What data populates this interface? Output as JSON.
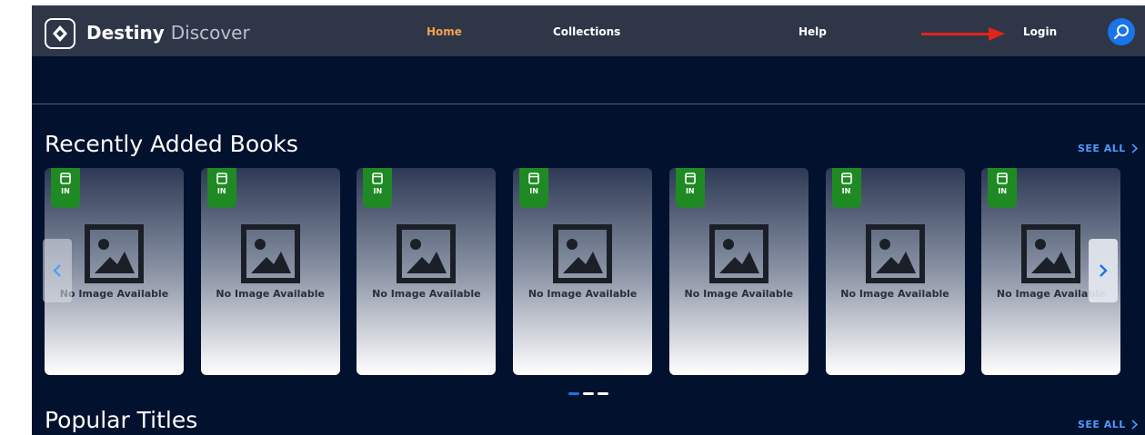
{
  "brand": {
    "name_primary": "Destiny",
    "name_secondary": "Discover",
    "logo_icon": "destiny-logo-icon"
  },
  "nav": {
    "home": "Home",
    "collections": "Collections",
    "help": "Help",
    "login": "Login",
    "search_icon": "search-icon"
  },
  "colors": {
    "background": "#02112e",
    "navbar": "#2e3648",
    "active_nav": "#f6a04d",
    "accent": "#1a73e8",
    "badge": "#1f8a24",
    "annotation_arrow": "#e3241b"
  },
  "sections": {
    "recent": {
      "title": "Recently Added Books",
      "see_all": "SEE ALL",
      "cards": [
        {
          "badge": "IN",
          "image_text": "No Image Available"
        },
        {
          "badge": "IN",
          "image_text": "No Image Available"
        },
        {
          "badge": "IN",
          "image_text": "No Image Available"
        },
        {
          "badge": "IN",
          "image_text": "No Image Available"
        },
        {
          "badge": "IN",
          "image_text": "No Image Available"
        },
        {
          "badge": "IN",
          "image_text": "No Image Available"
        },
        {
          "badge": "IN",
          "image_text": "No Image Available"
        }
      ],
      "carousel_pages": 3,
      "active_page": 1
    },
    "popular": {
      "title": "Popular Titles",
      "see_all": "SEE ALL"
    }
  }
}
